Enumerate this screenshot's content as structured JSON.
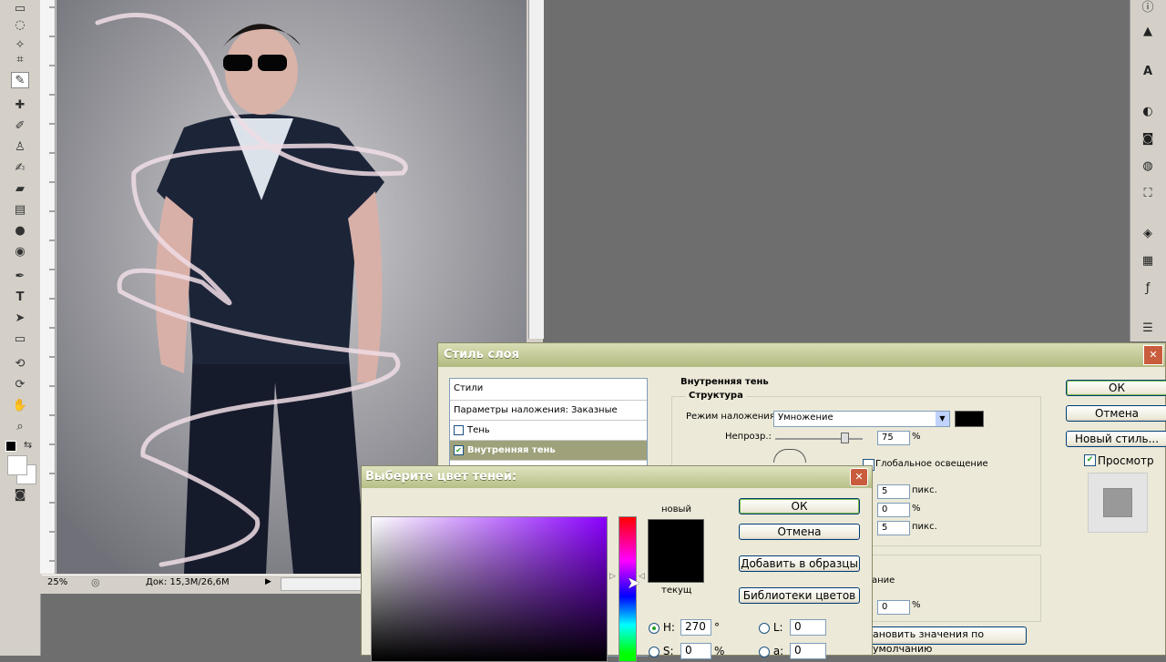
{
  "document": {
    "zoom": "25%",
    "doc_size": "Док: 15,3M/26,6M"
  },
  "tools": [
    "marquee-icon",
    "lasso-icon",
    "crop-icon",
    "eyedropper-icon",
    "healing-icon",
    "brush-icon",
    "stamp-icon",
    "history-brush-icon",
    "eraser-icon",
    "gradient-icon",
    "blur-icon",
    "dodge-icon",
    "pen-icon",
    "type-icon",
    "path-select-icon",
    "shape-icon",
    "3d-rotate-icon",
    "3d-orbit-icon",
    "hand-icon",
    "zoom-icon"
  ],
  "layer_style": {
    "title": "Стиль слоя",
    "styles_header": "Стили",
    "blend_options": "Параметры наложения: Заказные",
    "items": [
      {
        "label": "Тень",
        "checked": false
      },
      {
        "label": "Внутренняя тень",
        "checked": true
      }
    ],
    "section_title": "Внутренняя тень",
    "structure_title": "Структура",
    "blend_mode_label": "Режим наложения:",
    "blend_mode_value": "Умножение",
    "opacity_label": "Непрозр.:",
    "opacity_value": "75",
    "percent": "%",
    "global_light_label": "Глобальное освещение",
    "value_1": "5",
    "unit_px": "пикс.",
    "value_2": "0",
    "value_3": "5",
    "quality_partial": "ание",
    "noise_value": "0",
    "reset_default": "ановить значения по умолчанию",
    "ok": "ОК",
    "cancel": "Отмена",
    "new_style": "Новый стиль...",
    "preview": "Просмотр",
    "blend_color": "#000000"
  },
  "color_picker": {
    "title": "Выберите цвет теней:",
    "new_label": "новый",
    "current_label": "текущ",
    "ok": "ОК",
    "cancel": "Отмена",
    "add_swatches": "Добавить в образцы",
    "libraries": "Библиотеки цветов",
    "h_label": "H:",
    "h_value": "270",
    "h_unit": "°",
    "s_label": "S:",
    "s_value": "0",
    "s_unit": "%",
    "l_label": "L:",
    "l_value": "0",
    "a_label": "a:",
    "a_value": "0",
    "new_color": "#000000"
  }
}
